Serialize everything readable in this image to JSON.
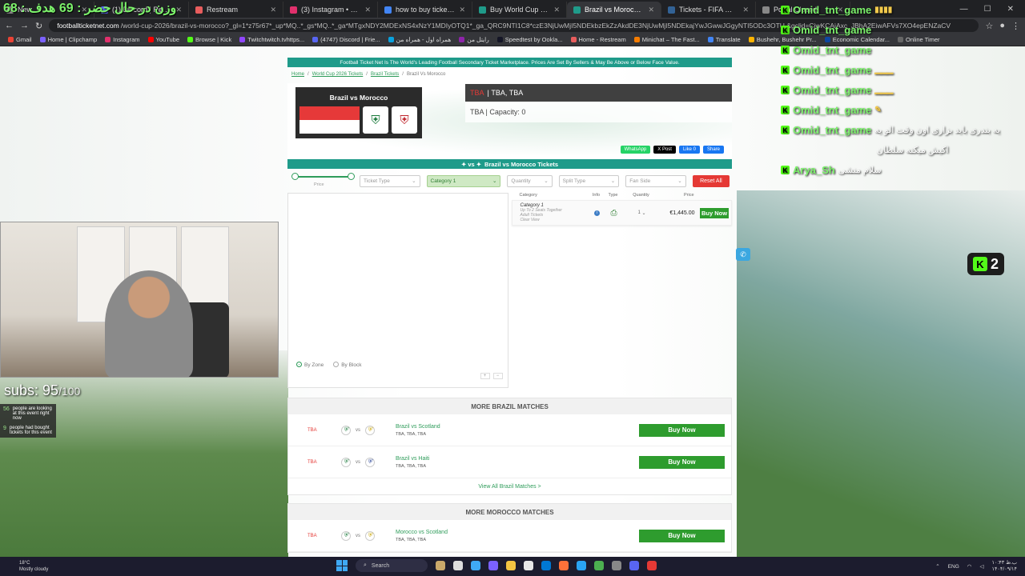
{
  "overlay": {
    "title": "وزن در حال حضر : 69 هدف : 68"
  },
  "browser": {
    "tabs": [
      {
        "title": "New",
        "color": "#888888",
        "active": false
      },
      {
        "title": "(1) Discord | Restream",
        "color": "#5865f2",
        "active": false
      },
      {
        "title": "Restream",
        "color": "#e85d5d",
        "active": false
      },
      {
        "title": "(3) Instagram • Messages",
        "color": "#e1306c",
        "active": false
      },
      {
        "title": "how to buy ticket for world cup",
        "color": "#4285f4",
        "active": false
      },
      {
        "title": "Buy World Cup 2026 Tickets 20",
        "color": "#1f9b8a",
        "active": false
      },
      {
        "title": "Brazil vs Morocco at TBA on 11",
        "color": "#1f9b8a",
        "active": true
      },
      {
        "title": "Tickets - FIFA World Cup 2026™",
        "color": "#326295",
        "active": false
      },
      {
        "title": "Portal Closed",
        "color": "#888888",
        "active": false
      }
    ],
    "url_domain": "footballticketnet.com",
    "url_path": "/world-cup-2026/brazil-vs-morocco?_gl=1*z75r67*_up*MQ..*_gs*MQ..*_ga*MTgxNDY2MDExNS4xNzY1MDIyOTQ1*_ga_QRC9NTI1C8*czE3NjUwMjI5NDEkbzEkZzAkdDE3NjUwMjI5NDEkajYwJGwwJGgyNTI5ODc3OTU.&gclid=CjwKCAiAxc_JBhA2EiwAFVs7XO4epENZaCV",
    "bookmarks": [
      {
        "label": "Gmail",
        "color": "#ea4335"
      },
      {
        "label": "Home | Clipchamp",
        "color": "#7b61ff"
      },
      {
        "label": "Instagram",
        "color": "#e1306c"
      },
      {
        "label": "YouTube",
        "color": "#ff0000"
      },
      {
        "label": "Browse | Kick",
        "color": "#53fc18"
      },
      {
        "label": "Twitchtwitch.tvhttps...",
        "color": "#9146ff"
      },
      {
        "label": "(4747) Discord | Frie...",
        "color": "#5865f2"
      },
      {
        "label": "همراه اول - همراه من",
        "color": "#0aa1dd"
      },
      {
        "label": "رایتل من",
        "color": "#8e24aa"
      },
      {
        "label": "Speedtest by Ookla...",
        "color": "#141526"
      },
      {
        "label": "Home - Restream",
        "color": "#e85d5d"
      },
      {
        "label": "Minichat – The Fast...",
        "color": "#f57c00"
      },
      {
        "label": "Translate",
        "color": "#4285f4"
      },
      {
        "label": "Bushehr, Bushehr Pr...",
        "color": "#ffb300"
      },
      {
        "label": "Economic Calendar...",
        "color": "#0d47a1"
      },
      {
        "label": "Online Timer",
        "color": "#666666"
      }
    ]
  },
  "page": {
    "banner": "Football Ticket Net Is The World's Leading Football Secondary Ticket Marketplace. Prices Are Set By Sellers & May Be Above or Below Face Value.",
    "breadcrumbs": [
      "Home",
      "World Cup 2026 Tickets",
      "Brazil Tickets",
      "Brazil Vs Morocco"
    ],
    "match_title": "Brazil vs Morocco",
    "info_red": "TBA",
    "info_line1": "TBA, TBA",
    "info_line2": "TBA  |  Capacity: 0",
    "share": {
      "whatsapp": "WhatsApp",
      "xpost": "X Post",
      "fb_like": "Like 0",
      "fb_share": "Share"
    },
    "subhead": "Brazil vs Morocco Tickets",
    "filters": {
      "price_label": "Price",
      "ticket_type": "Ticket Type",
      "category": "Category 1",
      "quantity": "Quantity",
      "split_type": "Split Type",
      "fan_side": "Fan Side",
      "reset": "Reset All"
    },
    "map": {
      "by_zone": "By Zone",
      "by_block": "By Block"
    },
    "list_headers": {
      "category": "Category",
      "info": "Info",
      "type": "Type",
      "quantity": "Quantity",
      "price": "Price"
    },
    "ticket": {
      "category": "Category 1",
      "details": [
        "Up To 2 Seats Together",
        "Adult Tickets",
        "Clear View"
      ],
      "qty": "1",
      "price": "€1,445.00",
      "buy": "Buy Now"
    },
    "more_brazil": {
      "heading": "MORE BRAZIL MATCHES",
      "matches": [
        {
          "date": "TBA",
          "name": "Brazil vs Scotland",
          "when": "TBA, TBA, TBA",
          "buy": "Buy Now"
        },
        {
          "date": "TBA",
          "name": "Brazil vs Haiti",
          "when": "TBA, TBA, TBA",
          "buy": "Buy Now"
        }
      ],
      "view_all": "View All Brazil Matches >"
    },
    "more_morocco": {
      "heading": "MORE MOROCCO MATCHES",
      "matches": [
        {
          "date": "TBA",
          "name": "Morocco vs Scotland",
          "when": "TBA, TBA, TBA",
          "buy": "Buy Now"
        }
      ]
    }
  },
  "stream": {
    "subs_label": "subs:",
    "subs_count": "95",
    "subs_goal": "/100",
    "viewers": [
      {
        "n": "56",
        "text": "people are looking at this event right now"
      },
      {
        "n": "9",
        "text": "people had bought tickets for this event"
      }
    ],
    "chat": [
      {
        "user": "Omid_tnt_game",
        "msg": "",
        "emo": "▮▮▮▮"
      },
      {
        "user": "Omid_tnt_game",
        "msg": "",
        "emo": ""
      },
      {
        "user": "Omid_tnt_game",
        "msg": "",
        "emo": ""
      },
      {
        "user": "Omid_tnt_game",
        "msg": "",
        "emo": "▁▁▁"
      },
      {
        "user": "Omid_tnt_game",
        "msg": "",
        "emo": "▁▁▁"
      },
      {
        "user": "Omid_tnt_game",
        "msg": "",
        "emo": "✎"
      },
      {
        "user": "Omid_tnt_game",
        "msg": "یه بندری باید بزاری اون وقت الو یه",
        "emo": ""
      },
      {
        "user": "",
        "msg": "اکیش میکنه سلطان",
        "emo": ""
      },
      {
        "user": "Arya_Sh",
        "msg": "سلام منشی",
        "emo": ""
      }
    ],
    "kick_count": "2"
  },
  "taskbar": {
    "weather_temp": "18°C",
    "weather_desc": "Mostly cloudy",
    "search": "Search",
    "lang": "ENG",
    "time": "۱۰:۴۳ ب.ظ",
    "date": "۱۴۰۴/۰۹/۱۴"
  }
}
